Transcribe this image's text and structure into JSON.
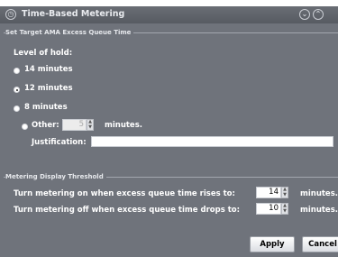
{
  "window": {
    "title": "Time-Based Metering",
    "title_icon": "clock-icon",
    "controls": [
      "minimize-icon",
      "maximize-icon"
    ]
  },
  "queue_group": {
    "title": "Set Target AMA Excess Queue Time",
    "level_label": "Level of hold:",
    "options": [
      {
        "label": "14 minutes",
        "selected": false
      },
      {
        "label": "12 minutes",
        "selected": true
      },
      {
        "label": "8 minutes",
        "selected": false
      }
    ],
    "other": {
      "label": "Other:",
      "value": "5",
      "units": "minutes.",
      "selected": false
    },
    "justification": {
      "label": "Justification:",
      "value": ""
    }
  },
  "threshold_group": {
    "title": "Metering Display Threshold",
    "on": {
      "label": "Turn metering on when excess queue time rises to:",
      "value": "14",
      "units": "minutes."
    },
    "off": {
      "label": "Turn metering off when excess queue time drops to:",
      "value": "10",
      "units": "minutes."
    }
  },
  "buttons": {
    "apply": "Apply",
    "cancel": "Cancel"
  }
}
